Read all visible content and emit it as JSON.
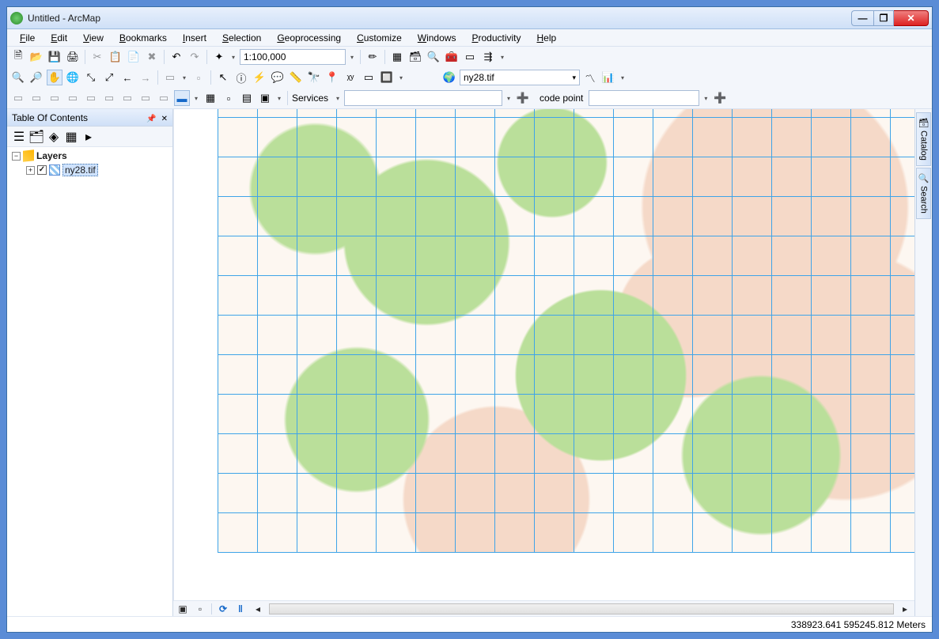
{
  "window": {
    "title": "Untitled - ArcMap"
  },
  "menus": [
    "File",
    "Edit",
    "View",
    "Bookmarks",
    "Insert",
    "Selection",
    "Geoprocessing",
    "Customize",
    "Windows",
    "Productivity",
    "Help"
  ],
  "toolbar": {
    "scale": "1:100,000",
    "layer_combo": "ny28.tif",
    "services_label": "Services",
    "codepoint_label": "code point"
  },
  "toc": {
    "title": "Table Of Contents",
    "root": "Layers",
    "item": "ny28.tif"
  },
  "sidetabs": [
    "Catalog",
    "Search"
  ],
  "status": {
    "coords": "338923.641 595245.812 Meters"
  }
}
